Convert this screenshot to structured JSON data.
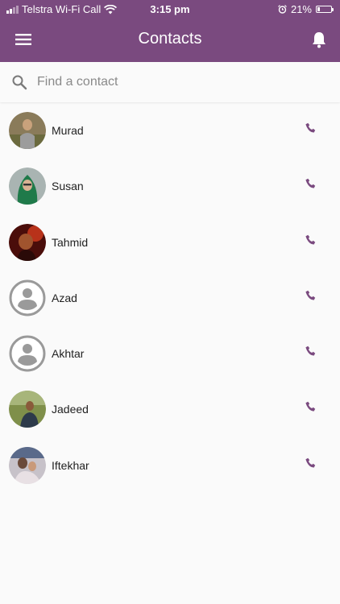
{
  "status_bar": {
    "carrier": "Telstra Wi-Fi Call",
    "time": "3:15 pm",
    "battery_percent": "21%",
    "battery_level": 0.21,
    "signal_bars_active": 2,
    "signal_bars_total": 4
  },
  "header": {
    "title": "Contacts",
    "menu_icon": "hamburger-menu-icon",
    "bell_icon": "bell-icon",
    "background_color": "#7a4a7f"
  },
  "search": {
    "placeholder": "Find a contact",
    "value": "",
    "icon": "search-icon"
  },
  "contacts": [
    {
      "name": "Murad",
      "avatar": "photo"
    },
    {
      "name": "Susan",
      "avatar": "photo"
    },
    {
      "name": "Tahmid",
      "avatar": "photo"
    },
    {
      "name": "Azad",
      "avatar": "default-person-icon"
    },
    {
      "name": "Akhtar",
      "avatar": "default-person-icon"
    },
    {
      "name": "Jadeed",
      "avatar": "photo"
    },
    {
      "name": "Iftekhar",
      "avatar": "photo"
    }
  ],
  "accent_color": "#7a4a7f"
}
